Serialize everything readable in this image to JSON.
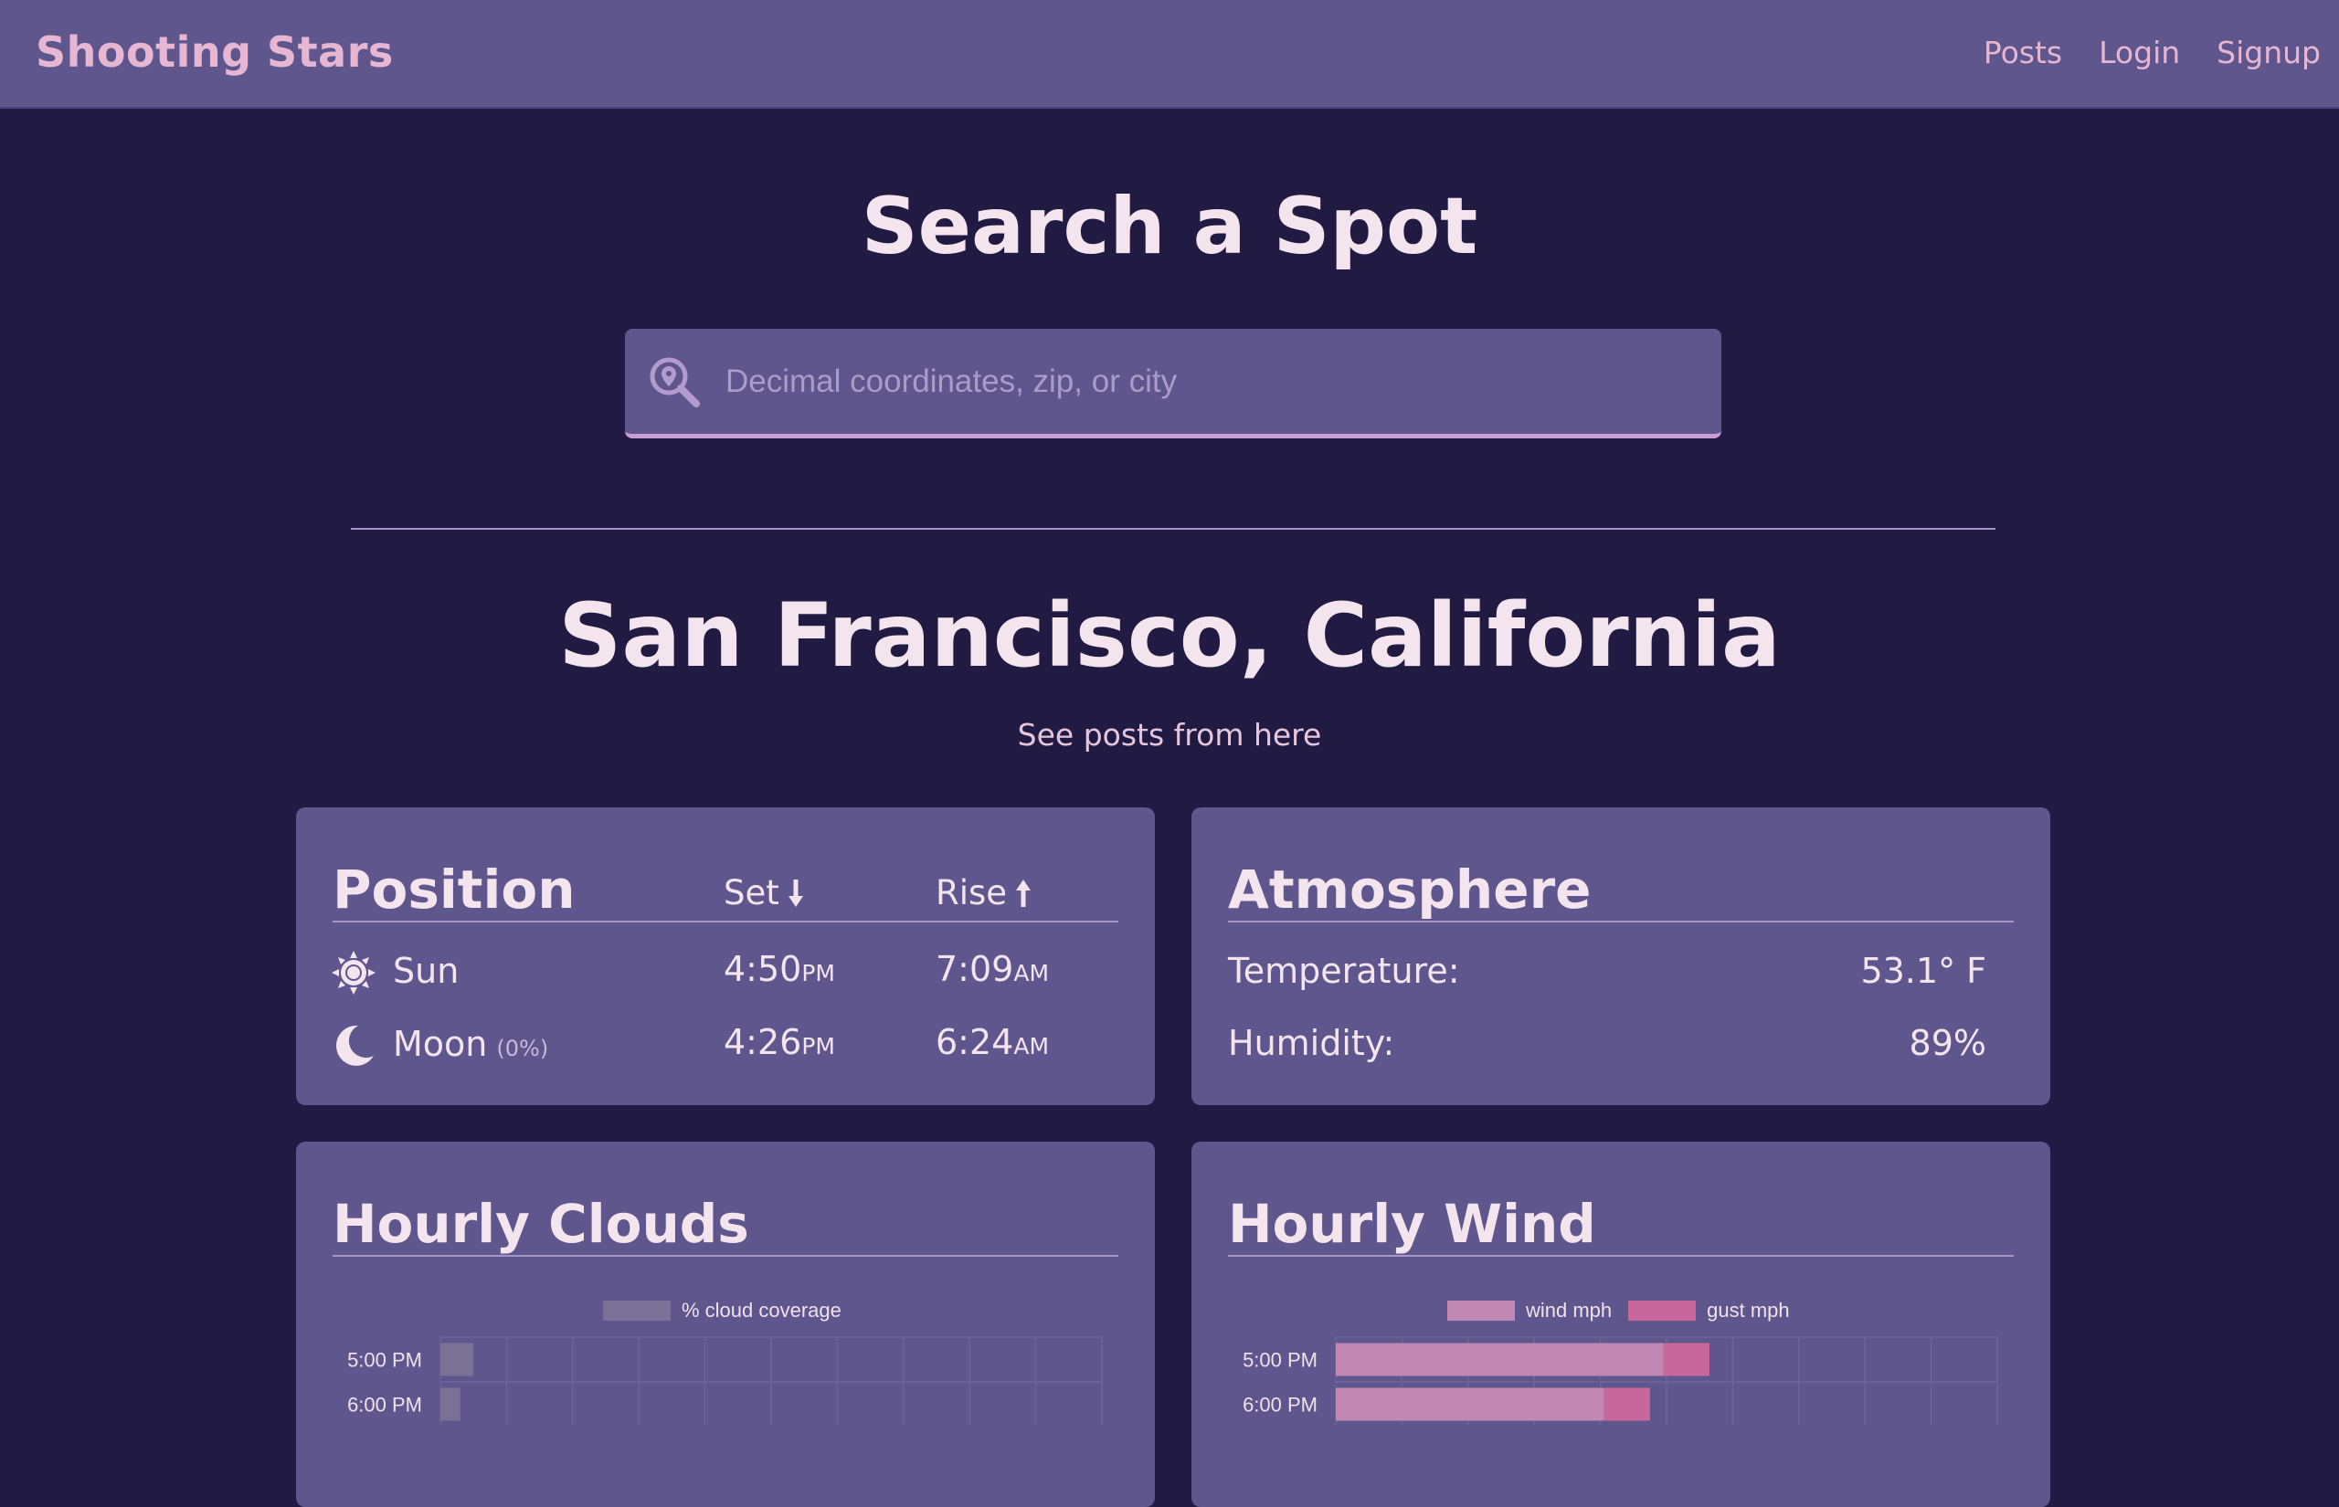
{
  "nav": {
    "brand": "Shooting Stars",
    "links": [
      "Posts",
      "Login",
      "Signup"
    ]
  },
  "search": {
    "title": "Search a Spot",
    "placeholder": "Decimal coordinates, zip, or city",
    "icon": "search-location-icon"
  },
  "location": {
    "title": "San Francisco, California",
    "posts_link": "See posts from here"
  },
  "position": {
    "title": "Position",
    "set_label": "Set",
    "rise_label": "Rise",
    "sun": {
      "name": "Sun",
      "icon": "sun-icon",
      "set_time": "4:50",
      "set_ampm": "PM",
      "rise_time": "7:09",
      "rise_ampm": "AM"
    },
    "moon": {
      "name": "Moon",
      "illumination": "(0%)",
      "icon": "moon-icon",
      "set_time": "4:26",
      "set_ampm": "PM",
      "rise_time": "6:24",
      "rise_ampm": "AM"
    }
  },
  "atmosphere": {
    "title": "Atmosphere",
    "temperature_label": "Temperature:",
    "temperature_value": "53.1° F",
    "humidity_label": "Humidity:",
    "humidity_value": "89%"
  },
  "clouds": {
    "title": "Hourly Clouds"
  },
  "wind": {
    "title": "Hourly Wind"
  },
  "colors": {
    "background": "#211a42",
    "panel": "#5e568c",
    "brand": "#e6b6d2",
    "cloud_bar": "#7a7296",
    "wind_bar": "#c088b3",
    "gust_bar": "#c8679a"
  },
  "chart_data": [
    {
      "type": "bar",
      "orientation": "horizontal",
      "categories": [
        "5:00 PM",
        "6:00 PM"
      ],
      "series": [
        {
          "name": "% cloud coverage",
          "values": [
            5,
            3
          ]
        }
      ],
      "xlim": [
        0,
        100
      ]
    },
    {
      "type": "bar",
      "orientation": "horizontal",
      "categories": [
        "5:00 PM",
        "6:00 PM"
      ],
      "series": [
        {
          "name": "wind mph",
          "values": [
            9.9,
            8.1
          ]
        },
        {
          "name": "gust mph",
          "values": [
            11.3,
            9.5
          ]
        }
      ],
      "xlim": [
        0,
        20
      ]
    }
  ]
}
